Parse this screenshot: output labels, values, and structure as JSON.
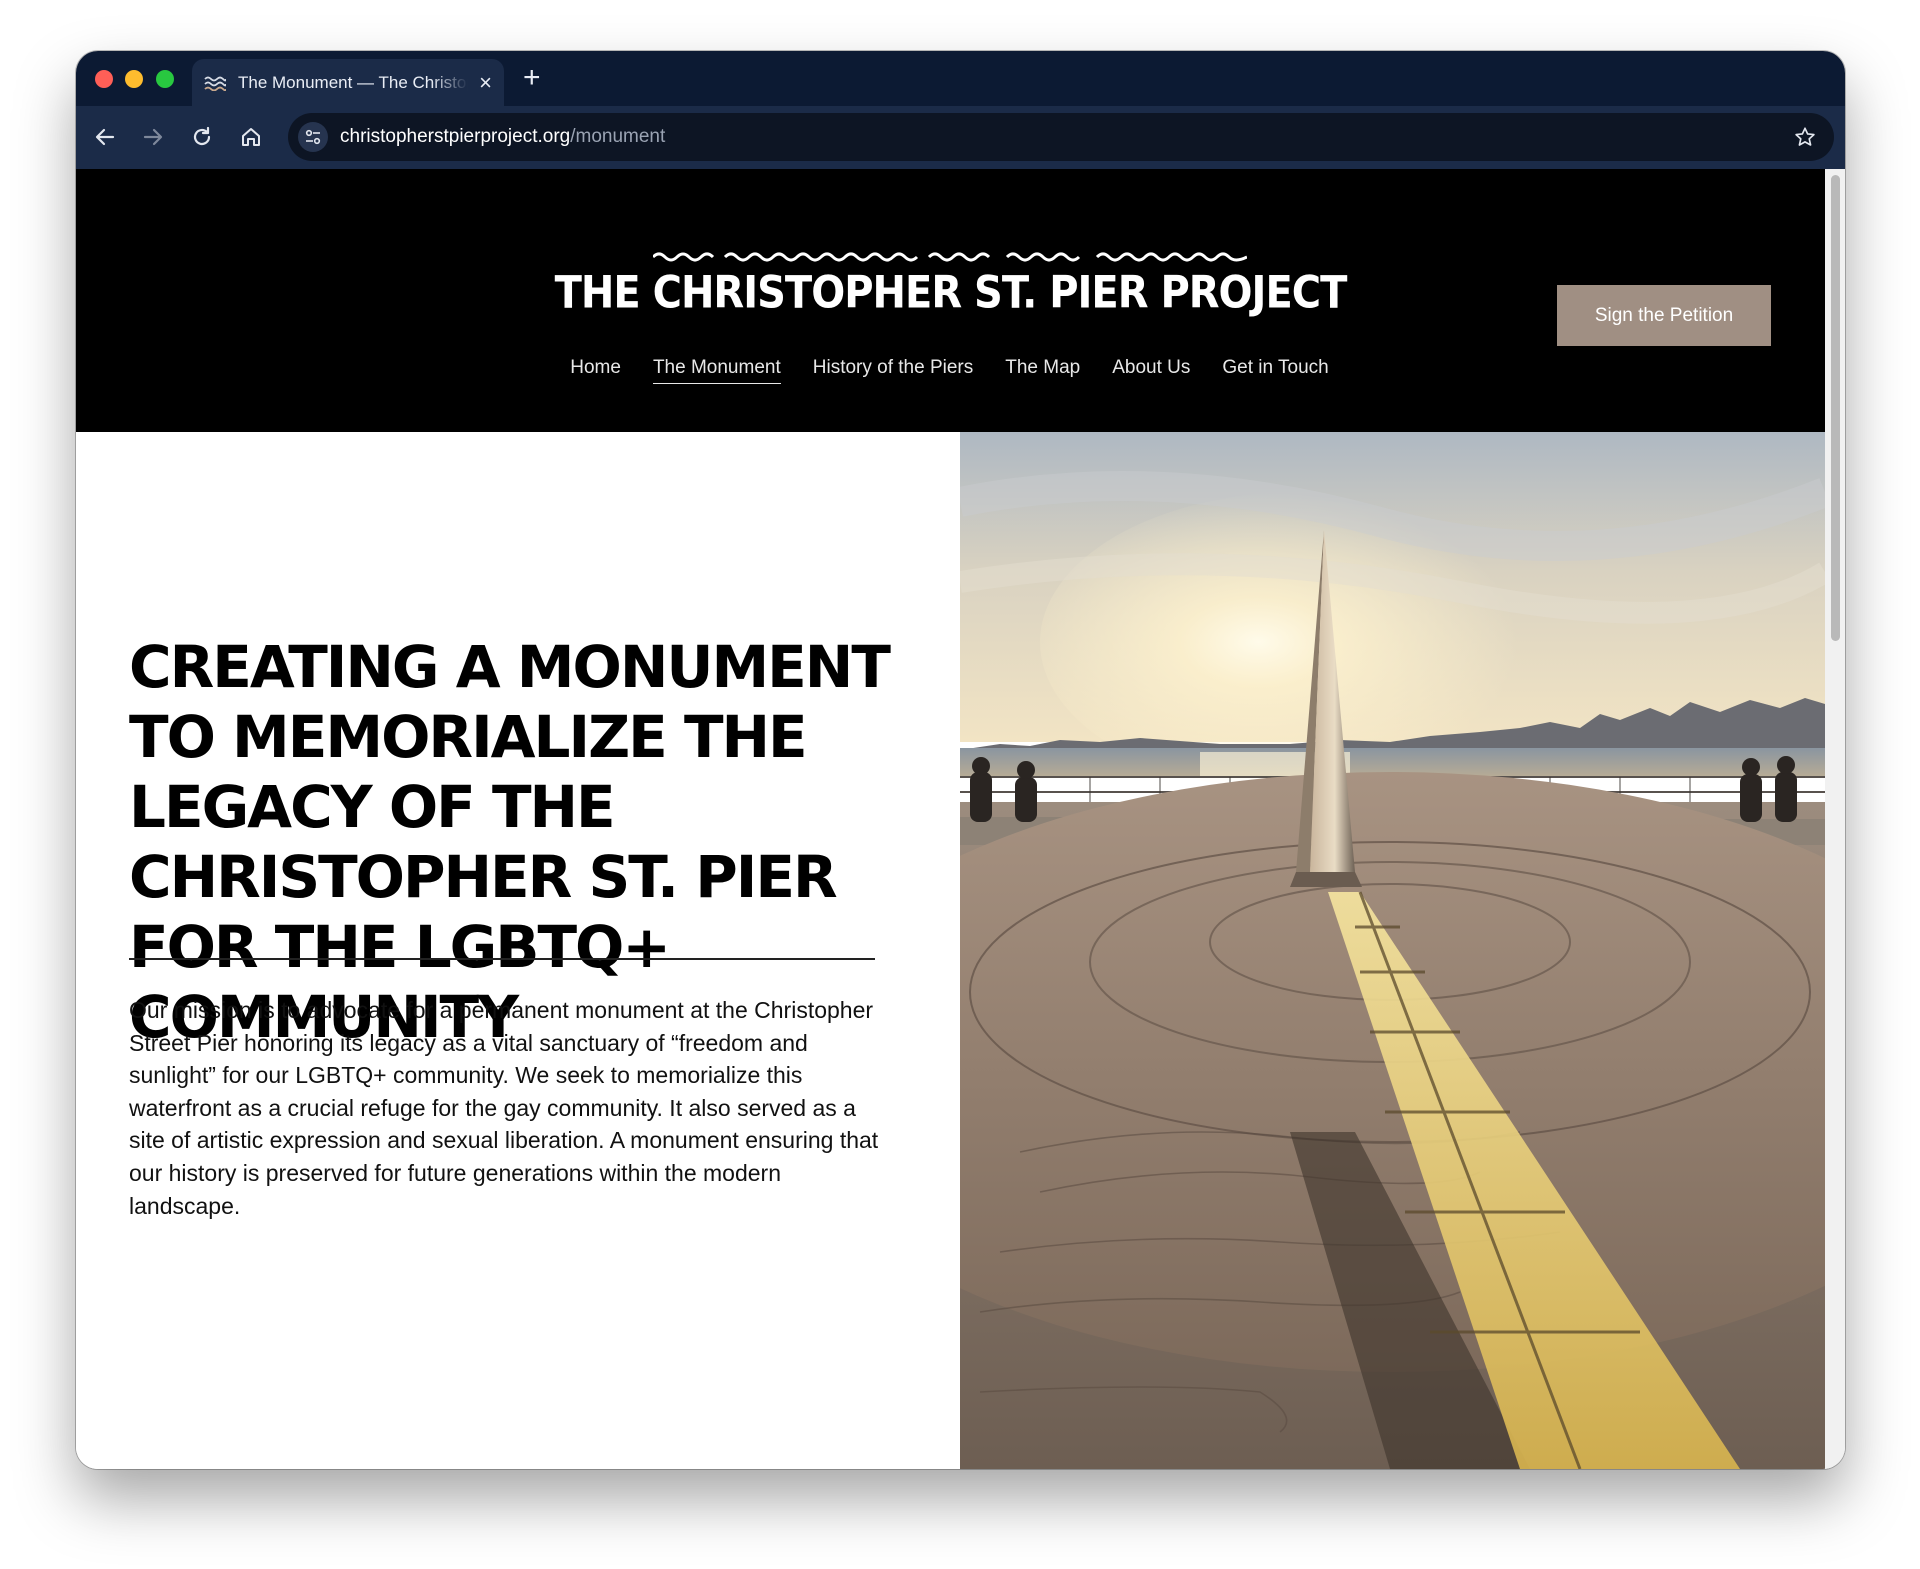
{
  "browser": {
    "tab_title": "The Monument — The Christopher St. Pier Project",
    "new_tab_label": "+",
    "url_domain": "christopherstpierproject.org",
    "url_path": "/monument",
    "icons": [
      "back-icon",
      "forward-icon",
      "reload-icon",
      "home-icon",
      "site-settings-icon",
      "bookmark-star-icon",
      "close-icon"
    ]
  },
  "site": {
    "logo_text": "THE CHRISTOPHER ST. PIER PROJECT",
    "petition_button": "Sign the Petition",
    "nav": [
      {
        "label": "Home",
        "active": false
      },
      {
        "label": "The Monument",
        "active": true
      },
      {
        "label": "History of the Piers",
        "active": false
      },
      {
        "label": "The Map",
        "active": false
      },
      {
        "label": "About Us",
        "active": false
      },
      {
        "label": "Get in Touch",
        "active": false
      }
    ]
  },
  "hero": {
    "headline": "Creating a monument to memorialize the legacy of the Christopher St. Pier for the LGBTQ+ community",
    "mission": "Our mission is to advocate for a permanent monument at the Christopher Street Pier honoring its legacy as a vital sanctuary of “freedom and sunlight” for our LGBTQ+ community. We seek to memorialize this waterfront as a crucial refuge for the gay community. It also served as a site of artistic expression and sexual liberation. A monument ensuring that our history is preserved for future generations within the modern landscape.",
    "image_subject": "obelisk-monument-on-pier-at-sunset"
  },
  "colors": {
    "browser_frame": "#0c1a33",
    "toolbar": "#1b2b48",
    "header_bg": "#000000",
    "petition_button": "#a08f83",
    "text": "#111111"
  }
}
